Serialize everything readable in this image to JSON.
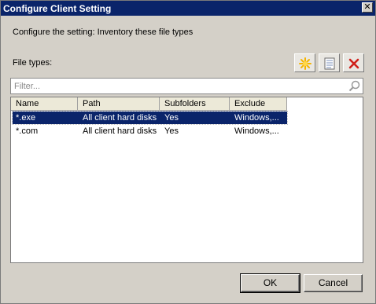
{
  "window": {
    "title": "Configure Client Setting",
    "close_glyph": "✕"
  },
  "description": "Configure the setting: Inventory these file types",
  "file_types_label": "File types:",
  "toolbar": {
    "new_icon": "new-item-icon",
    "properties_icon": "properties-icon",
    "delete_icon": "delete-icon",
    "colors": {
      "new": "#f5b400",
      "delete": "#d0201a"
    }
  },
  "filter": {
    "placeholder": "Filter...",
    "value": ""
  },
  "list": {
    "columns": [
      "Name",
      "Path",
      "Subfolders",
      "Exclude"
    ],
    "rows": [
      {
        "name": "*.exe",
        "path": "All client hard disks",
        "subfolders": "Yes",
        "exclude": "Windows,...",
        "selected": true
      },
      {
        "name": "*.com",
        "path": "All client hard disks",
        "subfolders": "Yes",
        "exclude": "Windows,...",
        "selected": false
      }
    ]
  },
  "buttons": {
    "ok": "OK",
    "cancel": "Cancel"
  },
  "colors": {
    "titlebar": "#0a246a",
    "selection": "#0a246a",
    "dialog_bg": "#d4d0c8"
  }
}
